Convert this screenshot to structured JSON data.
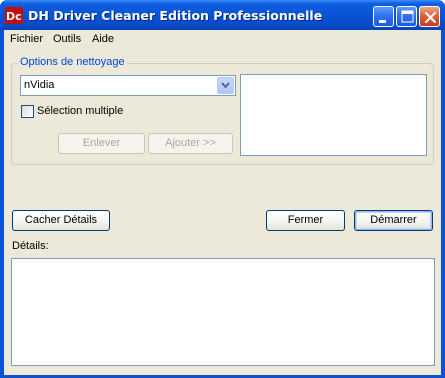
{
  "window": {
    "title": "DH Driver Cleaner Edition Professionnelle"
  },
  "menu": {
    "items": [
      "Fichier",
      "Outils",
      "Aide"
    ]
  },
  "options": {
    "legend": "Options de nettoyage",
    "driver_select": {
      "value": "nVidia"
    },
    "multi_select_label": "Sélection multiple",
    "multi_select_checked": false,
    "remove_label": "Enlever",
    "add_label": "Ajouter >>"
  },
  "actions": {
    "hide_details_label": "Cacher Détails",
    "close_label": "Fermer",
    "start_label": "Démarrer"
  },
  "details": {
    "label": "Détails:",
    "text": ""
  },
  "colors": {
    "titlebar": "#0a52d4",
    "client_bg": "#ece9d8",
    "legend_text": "#0046d5",
    "disabled_text": "#aca899"
  }
}
